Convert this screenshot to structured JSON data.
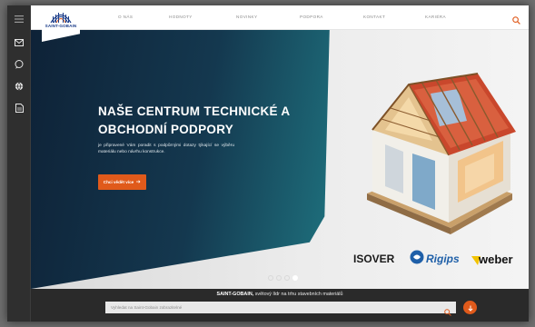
{
  "nav": {
    "items": [
      "O NÁS",
      "HODNOTY",
      "NOVINKY",
      "PODPORA",
      "KONTAKT",
      "KARIÉRA"
    ]
  },
  "logo": {
    "text": "SAINT-GOBAIN"
  },
  "rail": {
    "icons": [
      "menu-icon",
      "mail-icon",
      "chat-icon",
      "globe-icon",
      "document-icon"
    ]
  },
  "hero": {
    "title": "NAŠE CENTRUM TECHNICKÉ A OBCHODNÍ PODPORY",
    "description": "je připravené Vám poradit s podpůrnými dotazy týkající se výběru materiálu nebo návrhu konstrukce.",
    "button_label": "Chci vědět více",
    "slides": 4,
    "active_slide": 4
  },
  "brands": [
    "ISOVER",
    "Rigips",
    "weber"
  ],
  "bottom": {
    "tagline_brand": "SAINT-GOBAIN,",
    "tagline_rest": " světový lídr na trhu stavebních materiálů",
    "search_placeholder": "Vyhledat na Saint-Gobain zobrazitelné"
  },
  "colors": {
    "accent": "#e05a1b",
    "brand_blue": "#1d3e8a",
    "hero_dark": "#0e2237",
    "hero_teal": "#2c8a8e"
  }
}
